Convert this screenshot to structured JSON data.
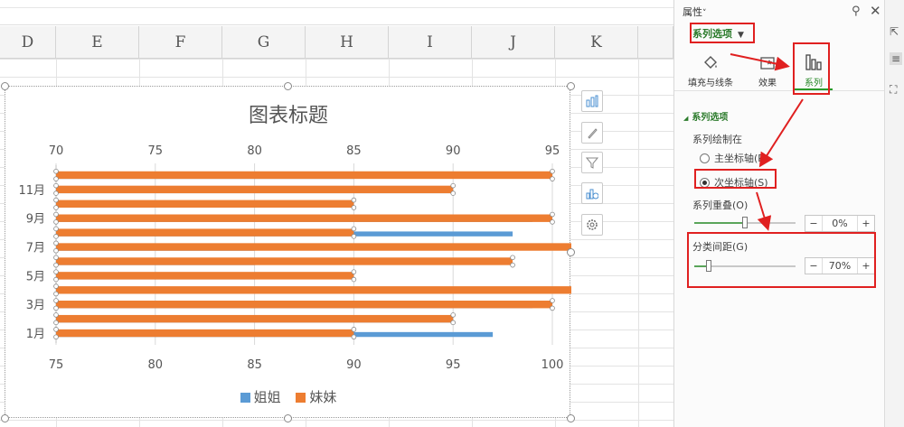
{
  "spreadsheet": {
    "columns": [
      "D",
      "E",
      "F",
      "G",
      "H",
      "I",
      "J",
      "K"
    ]
  },
  "chart_data": {
    "type": "bar",
    "title": "图表标题",
    "categories": [
      "1月",
      "",
      "3月",
      "",
      "5月",
      "",
      "7月",
      "",
      "9月",
      "",
      "11月",
      ""
    ],
    "category_tick_labels": [
      "1月",
      "3月",
      "5月",
      "7月",
      "9月",
      "11月"
    ],
    "series": [
      {
        "name": "姐姐",
        "axis": "primary",
        "color": "#5b9bd5",
        "values": [
          97,
          95,
          99,
          85,
          85,
          85,
          85,
          98,
          99,
          85,
          95,
          90
        ]
      },
      {
        "name": "妹妹",
        "axis": "secondary",
        "color": "#ed7d31",
        "values": [
          85,
          90,
          95,
          97,
          85,
          93,
          97,
          85,
          95,
          85,
          90,
          95
        ]
      }
    ],
    "primary_axis": {
      "min": 75,
      "max": 100,
      "ticks": [
        "75",
        "80",
        "85",
        "90",
        "95",
        "100"
      ]
    },
    "secondary_axis": {
      "min": 70,
      "max": 95,
      "ticks": [
        "70",
        "75",
        "80",
        "85",
        "90",
        "95"
      ]
    },
    "legend_position": "bottom",
    "gridlines": true
  },
  "chart_tools": [
    "chart-elements-icon",
    "chart-styles-icon",
    "chart-filter-icon",
    "chart-settings-icon",
    "gear-icon"
  ],
  "panel": {
    "title": "属性",
    "title_caret": "˅",
    "pin": "⚲",
    "close": "✕",
    "dropdown_label": "系列选项",
    "tabs": [
      {
        "label": "填充与线条",
        "icon": "fill-bucket-icon"
      },
      {
        "label": "效果",
        "icon": "effects-icon"
      },
      {
        "label": "系列",
        "icon": "series-bars-icon"
      }
    ],
    "section_title": "系列选项",
    "plot_on_label": "系列绘制在",
    "radio_primary": "主坐标轴(P)",
    "radio_secondary": "次坐标轴(S)",
    "overlap_label": "系列重叠(O)",
    "overlap_value": "0%",
    "overlap_fraction": 0.5,
    "gap_label": "分类间距(G)",
    "gap_value": "70%",
    "gap_fraction": 0.14,
    "minus": "−",
    "plus": "+"
  }
}
